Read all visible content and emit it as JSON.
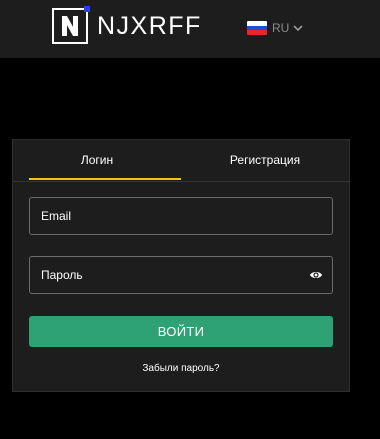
{
  "header": {
    "brand_letter": "N",
    "brand_name": "NJXRFF",
    "language": {
      "code": "RU",
      "flag_icon": "russia-flag-icon",
      "chevron_icon": "chevron-down-icon"
    },
    "colors": {
      "background": "#1d1d1d",
      "logo_accent": "#2f3bff"
    }
  },
  "auth": {
    "tabs": [
      {
        "label": "Логин",
        "active": true
      },
      {
        "label": "Регистрация",
        "active": false
      }
    ],
    "email_placeholder": "Email",
    "email_value": "",
    "password_placeholder": "Пароль",
    "password_value": "",
    "password_toggle_icon": "eye-icon",
    "submit_label": "ВОЙТИ",
    "forgot_label": "Забыли пароль?",
    "colors": {
      "active_tab_indicator": "#f0c419",
      "submit_button": "#2ea274",
      "card_background": "#1d1d1d"
    }
  }
}
